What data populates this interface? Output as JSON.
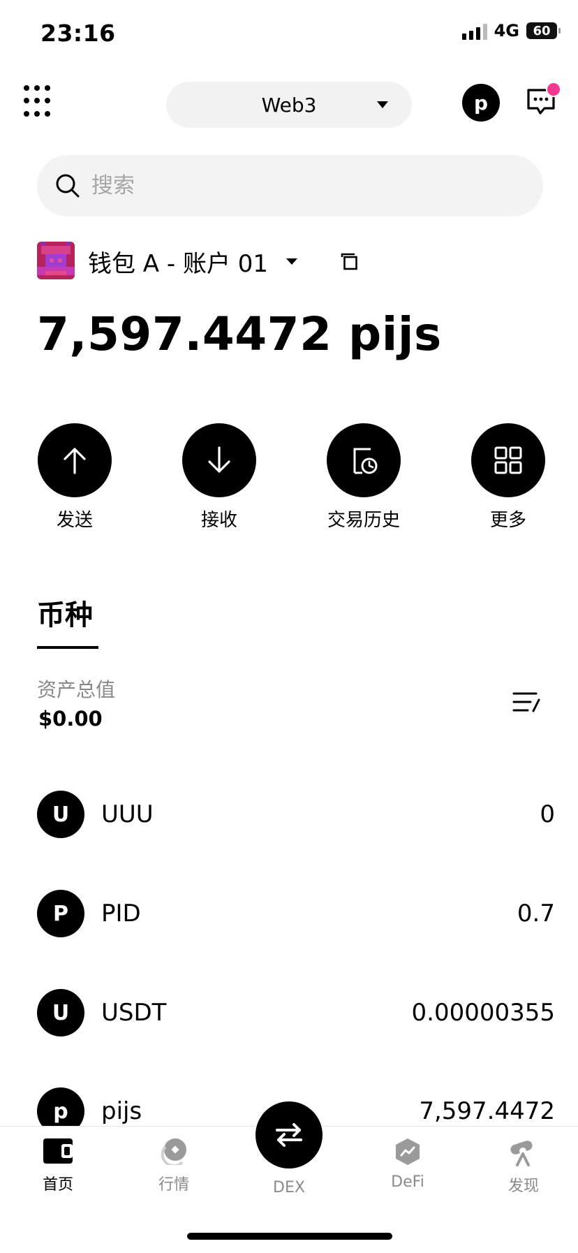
{
  "status_bar": {
    "time": "23:16",
    "network": "4G",
    "battery": "60"
  },
  "header": {
    "network_selector": "Web3",
    "avatar_letter": "p"
  },
  "search": {
    "placeholder": "搜索"
  },
  "wallet": {
    "name": "钱包 A - 账户 01",
    "balance": "7,597.4472 pijs"
  },
  "actions": [
    {
      "label": "发送",
      "icon": "arrow-up-icon"
    },
    {
      "label": "接收",
      "icon": "arrow-down-icon"
    },
    {
      "label": "交易历史",
      "icon": "history-icon"
    },
    {
      "label": "更多",
      "icon": "grid-icon"
    }
  ],
  "tabs": {
    "active": "币种"
  },
  "assets": {
    "label": "资产总值",
    "value": "$0.00"
  },
  "tokens": [
    {
      "letter": "U",
      "name": "UUU",
      "amount": "0"
    },
    {
      "letter": "P",
      "name": "PID",
      "amount": "0.7"
    },
    {
      "letter": "U",
      "name": "USDT",
      "amount": "0.00000355"
    },
    {
      "letter": "p",
      "name": "pijs",
      "amount": "7,597.4472"
    }
  ],
  "bottom_nav": {
    "home": "首页",
    "market": "行情",
    "dex": "DEX",
    "defi": "DeFi",
    "discover": "发现"
  },
  "colors": {
    "accent": "#000000",
    "notification_dot": "#f0398f",
    "search_bg": "#f3f3f3",
    "muted": "#8a8a8a"
  }
}
